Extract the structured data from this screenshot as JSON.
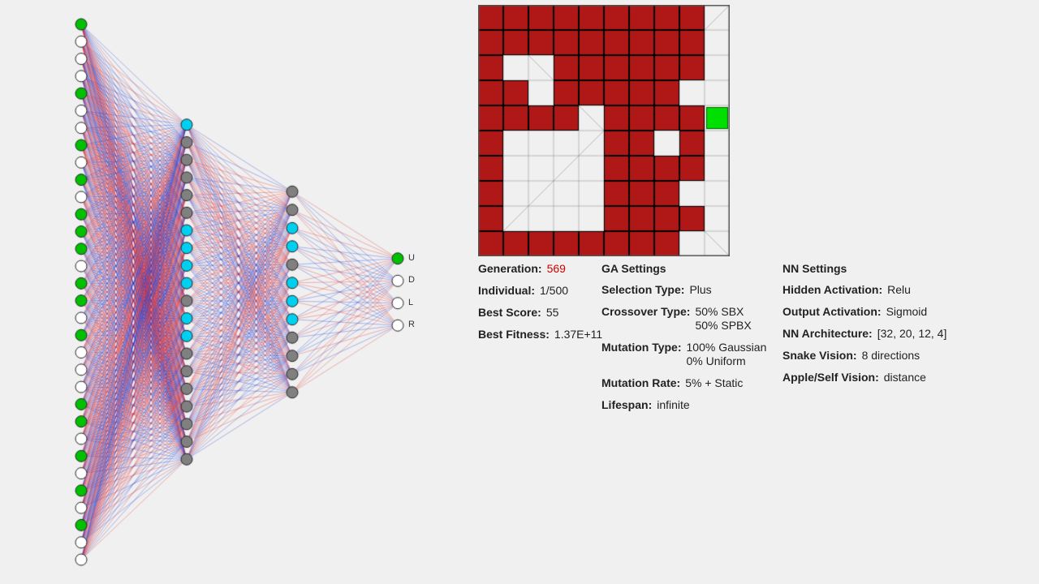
{
  "nn": {
    "layers": [
      32,
      20,
      12,
      4
    ],
    "input_active": [
      1,
      0,
      0,
      0,
      1,
      0,
      0,
      1,
      0,
      1,
      0,
      1,
      1,
      1,
      0,
      1,
      1,
      0,
      1,
      0,
      0,
      0,
      1,
      1,
      0,
      1,
      0,
      1,
      0,
      1,
      0,
      0
    ],
    "hidden1_active": [
      2,
      0,
      0,
      0,
      0,
      0,
      2,
      2,
      2,
      2,
      0,
      2,
      2,
      0,
      0,
      0,
      0,
      0,
      0,
      0
    ],
    "hidden2_active": [
      0,
      0,
      2,
      2,
      0,
      2,
      2,
      2,
      0,
      0,
      0,
      0
    ],
    "output_active": [
      1,
      0,
      0,
      0
    ],
    "output_labels": [
      "U",
      "D",
      "L",
      "R"
    ]
  },
  "game": {
    "grid": 10,
    "snake": [
      [
        0,
        0
      ],
      [
        1,
        0
      ],
      [
        2,
        0
      ],
      [
        3,
        0
      ],
      [
        4,
        0
      ],
      [
        0,
        1
      ],
      [
        1,
        1
      ],
      [
        2,
        1
      ],
      [
        3,
        1
      ],
      [
        4,
        1
      ],
      [
        0,
        2
      ],
      [
        3,
        2
      ],
      [
        4,
        2
      ],
      [
        0,
        3
      ],
      [
        1,
        3
      ],
      [
        3,
        3
      ],
      [
        4,
        3
      ],
      [
        0,
        4
      ],
      [
        1,
        4
      ],
      [
        2,
        4
      ],
      [
        3,
        4
      ],
      [
        0,
        5
      ],
      [
        0,
        6
      ],
      [
        0,
        7
      ],
      [
        0,
        8
      ],
      [
        0,
        9
      ],
      [
        1,
        9
      ],
      [
        2,
        9
      ],
      [
        3,
        9
      ],
      [
        4,
        9
      ],
      [
        5,
        0
      ],
      [
        6,
        0
      ],
      [
        7,
        0
      ],
      [
        8,
        0
      ],
      [
        5,
        1
      ],
      [
        6,
        1
      ],
      [
        7,
        1
      ],
      [
        8,
        1
      ],
      [
        5,
        2
      ],
      [
        6,
        2
      ],
      [
        7,
        2
      ],
      [
        8,
        2
      ],
      [
        5,
        3
      ],
      [
        6,
        3
      ],
      [
        7,
        3
      ],
      [
        5,
        4
      ],
      [
        6,
        4
      ],
      [
        7,
        4
      ],
      [
        8,
        4
      ],
      [
        5,
        5
      ],
      [
        6,
        5
      ],
      [
        8,
        5
      ],
      [
        5,
        6
      ],
      [
        6,
        6
      ],
      [
        7,
        6
      ],
      [
        8,
        6
      ],
      [
        5,
        7
      ],
      [
        6,
        7
      ],
      [
        7,
        7
      ],
      [
        5,
        8
      ],
      [
        6,
        8
      ],
      [
        7,
        8
      ],
      [
        8,
        8
      ],
      [
        5,
        9
      ],
      [
        6,
        9
      ],
      [
        7,
        9
      ]
    ],
    "apple": [
      9,
      4
    ]
  },
  "stats": {
    "generation_label": "Generation:",
    "generation_value": "569",
    "individual_label": "Individual:",
    "individual_value": "1/500",
    "best_score_label": "Best Score:",
    "best_score_value": "55",
    "best_fitness_label": "Best Fitness:",
    "best_fitness_value": "1.37E+11"
  },
  "ga": {
    "header": "GA Settings",
    "selection_label": "Selection Type:",
    "selection_value": "Plus",
    "crossover_label": "Crossover Type:",
    "crossover_value": "50% SBX\n50% SPBX",
    "mutation_type_label": "Mutation Type:",
    "mutation_type_value": "100% Gaussian\n0% Uniform",
    "mutation_rate_label": "Mutation Rate:",
    "mutation_rate_value": "5% + Static",
    "lifespan_label": "Lifespan:",
    "lifespan_value": "infinite"
  },
  "nnset": {
    "header": "NN Settings",
    "hidden_act_label": "Hidden Activation:",
    "hidden_act_value": "Relu",
    "output_act_label": "Output Activation:",
    "output_act_value": "Sigmoid",
    "arch_label": "NN Architecture:",
    "arch_value": "[32, 20, 12, 4]",
    "vision_label": "Snake Vision:",
    "vision_value": "8 directions",
    "apple_label": "Apple/Self Vision:",
    "apple_value": "distance"
  },
  "colors": {
    "pos_weight": "#1030d0",
    "neg_weight": "#e02020",
    "node_green": "#00c000",
    "node_cyan": "#00d0f0",
    "node_gray": "#808080",
    "node_white": "#ffffff",
    "node_stroke": "#222222",
    "snake_fill": "#b01818",
    "snake_stroke": "#000000",
    "apple": "#00e000",
    "grid_line": "#555555"
  }
}
